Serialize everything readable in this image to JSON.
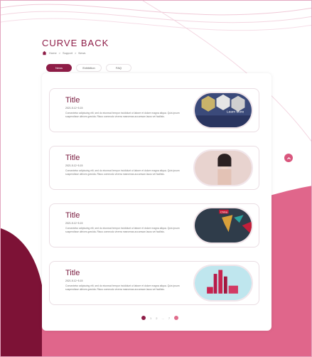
{
  "brand": {
    "name": "CURVE BACK"
  },
  "breadcrumb": {
    "items": [
      "Home",
      "Support",
      "News"
    ],
    "separator": ">"
  },
  "tabs": [
    {
      "label": "News",
      "active": true
    },
    {
      "label": "Exhibition",
      "active": false
    },
    {
      "label": "FAQ",
      "active": false
    }
  ],
  "news": [
    {
      "title": "Title",
      "date": "2021.5.12~5.15",
      "description": "Consectetur adipiscing elit, sed do eiusmod tempor incididunt ut labore et dolore magna aliqua. Quis ipsum suspendisse ultrices gravida. Risus commodo viverra maecenas accumsan lacus vel facilisis.",
      "image": "exhibition-photo",
      "image_caption": "Learn More"
    },
    {
      "title": "Title",
      "date": "2021.5.12~5.15",
      "description": "Consectetur adipiscing elit, sed do eiusmod tempor incididunt ut labore et dolore magna aliqua. Quis ipsum suspendisse ultrices gravida. Risus commodo viverra maecenas accumsan lacus vel facilisis.",
      "image": "model-portrait-photo"
    },
    {
      "title": "Title",
      "date": "2021.5.12~5.15",
      "description": "Consectetur adipiscing elit, sed do eiusmod tempor incididunt ut labore et dolore magna aliqua. Quis ipsum suspendisse ultrices gravida. Risus commodo viverra maecenas accumsan lacus vel facilisis.",
      "image": "china-expo-banner",
      "image_caption": "China"
    },
    {
      "title": "Title",
      "date": "2021.5.12~5.15",
      "description": "Consectetur adipiscing elit, sed do eiusmod tempor incididunt ut labore et dolore magna aliqua. Quis ipsum suspendisse ultrices gravida. Risus commodo viverra maecenas accumsan lacus vel facilisis.",
      "image": "cosmetic-bottles-photo"
    }
  ],
  "pagination": {
    "pages": [
      "1",
      "2",
      "...",
      "7"
    ]
  },
  "colors": {
    "primary": "#8e1d47",
    "accent": "#d9567d",
    "wave_pink": "#e0668b",
    "wave_dark": "#7d1236"
  }
}
